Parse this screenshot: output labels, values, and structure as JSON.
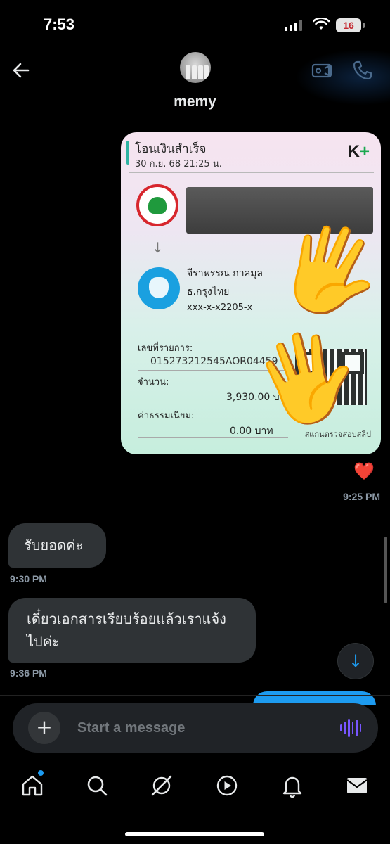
{
  "status_bar": {
    "time": "7:53",
    "battery": "16"
  },
  "header": {
    "contact_name": "memy"
  },
  "slip": {
    "title": "โอนเงินสำเร็จ",
    "date": "30 ก.ย. 68  21:25 น.",
    "logo_text": "K",
    "logo_plus": "+",
    "recipient_name": "จีราพรรณ กาลมุล",
    "recipient_bank": "ธ.กรุงไทย",
    "recipient_account": "xxx-x-x2205-x",
    "ref_label": "เลขที่รายการ:",
    "ref_value": "015273212545AOR04459",
    "amount_label": "จำนวน:",
    "amount_value": "3,930.00 บาท",
    "fee_label": "ค่าธรรมเนียม:",
    "fee_value": "0.00 บาท",
    "footer": "สแกนตรวจสอบสลิป"
  },
  "messages": {
    "sent_reaction": "❤️",
    "sent_time": "9:25 PM",
    "received": [
      {
        "text": "รับยอดค่ะ",
        "time": "9:30 PM"
      },
      {
        "text": "เดี๋ยวเอกสารเรียบร้อยแล้วเราแจ้งไปค่ะ",
        "time": "9:36 PM"
      }
    ]
  },
  "composer": {
    "placeholder": "Start a message",
    "add_label": "+"
  },
  "scroll_down_label": "↓",
  "icons": {
    "back": "arrow-left-icon",
    "video": "video-icon",
    "phone": "phone-icon",
    "voice": "voice-wave-icon",
    "home": "home-icon",
    "search": "search-icon",
    "grok": "grok-icon",
    "play": "play-icon",
    "bell": "bell-icon",
    "mail": "mail-icon"
  },
  "colors": {
    "accent": "#1d9bf0",
    "bubble_in": "#2f3336",
    "voice": "#7856ff"
  }
}
